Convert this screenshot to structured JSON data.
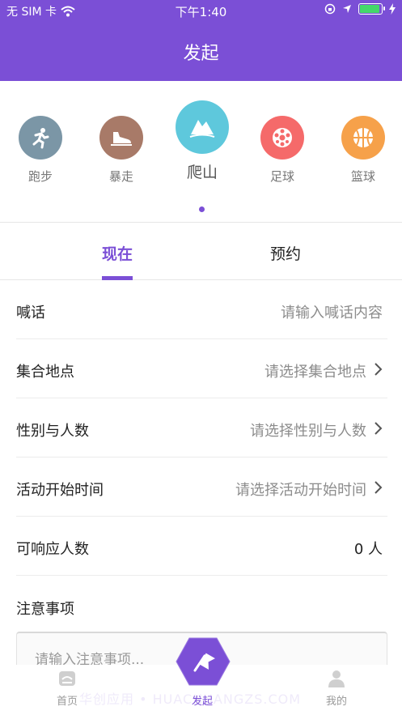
{
  "status_bar": {
    "carrier": "无 SIM 卡",
    "time": "下午1:40"
  },
  "header": {
    "title": "发起"
  },
  "sports": [
    {
      "label": "跑步",
      "color": "#7b96a6",
      "icon": "running-icon"
    },
    {
      "label": "暴走",
      "color": "#a87a68",
      "icon": "sneaker-icon"
    },
    {
      "label": "爬山",
      "color": "#5ec8dc",
      "icon": "mountain-icon",
      "active": true
    },
    {
      "label": "足球",
      "color": "#f56a6a",
      "icon": "soccer-ball-icon"
    },
    {
      "label": "篮球",
      "color": "#f6a14a",
      "icon": "basketball-icon"
    }
  ],
  "tabs": [
    {
      "label": "现在",
      "active": true
    },
    {
      "label": "预约"
    }
  ],
  "form": {
    "shout": {
      "label": "喊话",
      "placeholder": "请输入喊话内容"
    },
    "meeting_place": {
      "label": "集合地点",
      "value": "请选择集合地点"
    },
    "gender_count": {
      "label": "性别与人数",
      "value": "请选择性别与人数"
    },
    "start_time": {
      "label": "活动开始时间",
      "value": "请选择活动开始时间"
    },
    "responders": {
      "label": "可响应人数",
      "value": "0 人"
    },
    "notes": {
      "label": "注意事项",
      "placeholder": "请输入注意事项..."
    }
  },
  "tabbar": {
    "home": "首页",
    "launch": "发起",
    "mine": "我的"
  },
  "watermark": "华创应用 • HUACHUANGZS.COM",
  "colors": {
    "primary": "#7b4fd6"
  }
}
